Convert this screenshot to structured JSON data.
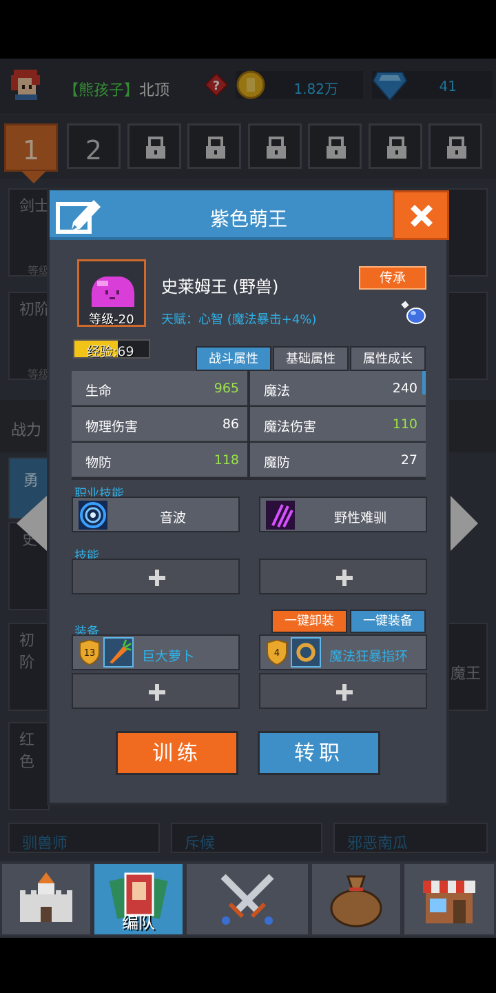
{
  "player": {
    "name_bracket": "【熊孩子】",
    "location": "北顶"
  },
  "resources": {
    "coins": "1.82万",
    "gems": "41"
  },
  "team_tabs": [
    {
      "label": "1",
      "state": "active"
    },
    {
      "label": "2",
      "state": "unlocked"
    },
    {
      "state": "locked"
    },
    {
      "state": "locked"
    },
    {
      "state": "locked"
    },
    {
      "state": "locked"
    },
    {
      "state": "locked"
    },
    {
      "state": "locked"
    }
  ],
  "background": {
    "combat_power_label": "战力",
    "cards": [
      "剑士",
      "初阶",
      "勇",
      "史",
      "初阶",
      "魔王",
      "红色",
      "驯兽师",
      "斥候",
      "邪恶南瓜"
    ],
    "level_prefix": "等级"
  },
  "modal": {
    "title": "紫色萌王",
    "unit_name": "史莱姆王 (野兽)",
    "talent": "天赋：心智 (魔法暴击+4%)",
    "level": "等级-20",
    "exp_label": "经验:69",
    "exp_fraction": 0.58,
    "inherit_label": "传承",
    "stat_tabs": [
      "战斗属性",
      "基础属性",
      "属性成长"
    ],
    "stats": [
      {
        "label": "生命",
        "value": "965",
        "color": "#9be24a"
      },
      {
        "label": "魔法",
        "value": "240",
        "color": "#ffffff"
      },
      {
        "label": "物理伤害",
        "value": "86",
        "color": "#ffffff"
      },
      {
        "label": "魔法伤害",
        "value": "110",
        "color": "#9be24a"
      },
      {
        "label": "物防",
        "value": "118",
        "color": "#9be24a"
      },
      {
        "label": "魔防",
        "value": "27",
        "color": "#ffffff"
      }
    ],
    "class_skills_label": "职业技能",
    "class_skills": [
      {
        "icon": "sound-wave-icon",
        "label": "音波"
      },
      {
        "icon": "claw-slash-icon",
        "label": "野性难驯"
      }
    ],
    "skills_label": "技能",
    "equipment_label": "装备",
    "unequip_all": "一键卸装",
    "equip_all": "一键装备",
    "equipment": [
      {
        "level": "13",
        "icon": "carrot-icon",
        "name": "巨大萝卜"
      },
      {
        "level": "4",
        "icon": "ring-icon",
        "name": "魔法狂暴指环"
      }
    ],
    "train_label": "训练",
    "job_change_label": "转职"
  },
  "nav": [
    {
      "icon": "castle-icon",
      "label": ""
    },
    {
      "icon": "formation-cards-icon",
      "label": "编队"
    },
    {
      "icon": "crossed-swords-icon",
      "label": ""
    },
    {
      "icon": "loot-bag-icon",
      "label": ""
    },
    {
      "icon": "shop-icon",
      "label": ""
    }
  ],
  "colors": {
    "accent_blue": "#3e8fc7",
    "accent_orange": "#f06a1f",
    "stat_green": "#9be24a",
    "text_blue": "#2fb1e8"
  }
}
